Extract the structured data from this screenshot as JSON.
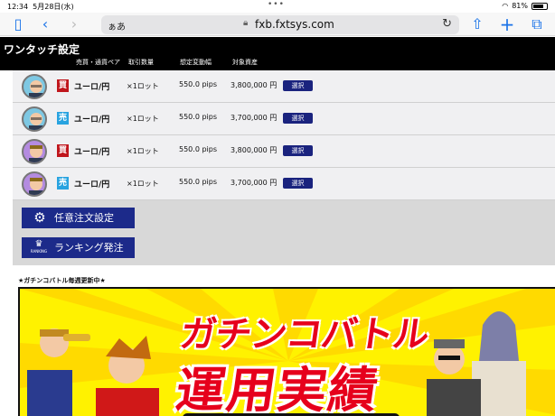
{
  "status": {
    "time": "12:34",
    "date": "5月28日(水)",
    "battery": "81%"
  },
  "browser": {
    "aa": "ぁあ",
    "url": "fxb.fxtsys.com"
  },
  "header": {
    "title": "ワンタッチ設定",
    "columns": [
      "売買・通貨ペア",
      "取引数量",
      "想定変動幅",
      "対象資産"
    ]
  },
  "rows": [
    {
      "side": "買",
      "pair": "ユーロ/円",
      "lot": "×1ロット",
      "pips": "550.0 pips",
      "asset": "3,800,000 円",
      "button": "選択",
      "side_type": "buy"
    },
    {
      "side": "売",
      "pair": "ユーロ/円",
      "lot": "×1ロット",
      "pips": "550.0 pips",
      "asset": "3,700,000 円",
      "button": "選択",
      "side_type": "sell"
    },
    {
      "side": "買",
      "pair": "ユーロ/円",
      "lot": "×1ロット",
      "pips": "550.0 pips",
      "asset": "3,800,000 円",
      "button": "選択",
      "side_type": "buy"
    },
    {
      "side": "売",
      "pair": "ユーロ/円",
      "lot": "×1ロット",
      "pips": "550.0 pips",
      "asset": "3,700,000 円",
      "button": "選択",
      "side_type": "sell"
    }
  ],
  "buttons": {
    "custom_order": "任意注文設定",
    "ranking_order": "ランキング発注",
    "ranking_icon": "RANKING"
  },
  "banner": {
    "heading": "★ガチンコバトル毎週更新中★",
    "title_line1": "ガチンコバトル",
    "title_line2": "運用実績"
  },
  "colors": {
    "buy": "#c0161c",
    "sell": "#28a3e0",
    "button": "#1a237e",
    "banner_title": "#e6001c",
    "banner_bg": "#fff200"
  }
}
